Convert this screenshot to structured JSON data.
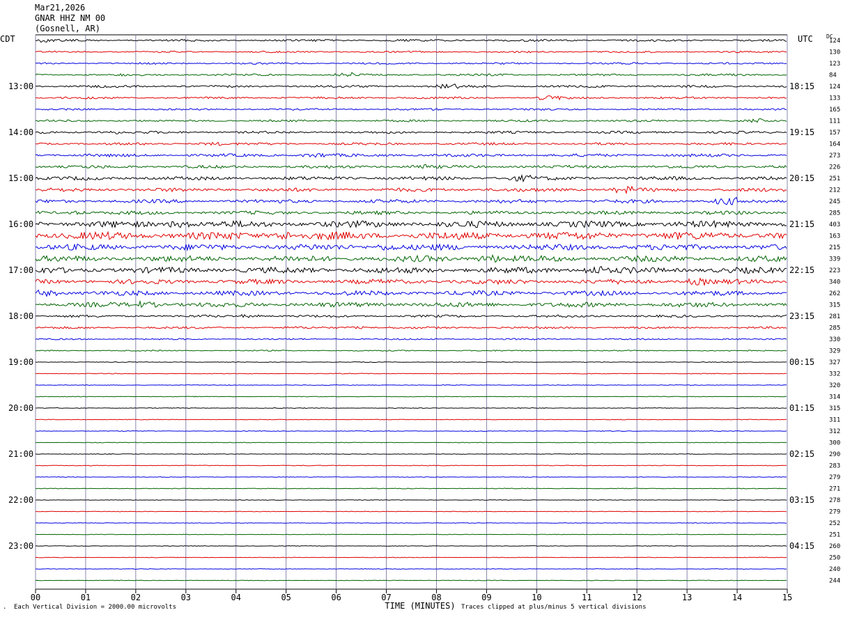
{
  "header": {
    "date": "Mar21,2026",
    "station": "GNAR HHZ NM 00",
    "location": "(Gosnell, AR)"
  },
  "left_label": "CDT",
  "right_label": "UTC",
  "dc_label": "DC",
  "footer": {
    "scale_note": "Each Vertical Division = 2000.00 microvolts",
    "xlabel": "TIME (MINUTES)",
    "clip_note": "Traces clipped at plus/minus 5 vertical divisions",
    "corner_mark": "."
  },
  "colors": {
    "cycle": [
      "#000000",
      "#e00000",
      "#0000e0",
      "#006400"
    ],
    "grid": "#6a6a9a"
  },
  "chart_data": {
    "type": "line",
    "title": "GNAR HHZ NM 00",
    "xlabel": "TIME (MINUTES)",
    "xlim": [
      0,
      15
    ],
    "x_ticks": [
      "00",
      "01",
      "02",
      "03",
      "04",
      "05",
      "06",
      "07",
      "08",
      "09",
      "10",
      "11",
      "12",
      "13",
      "14",
      "15"
    ],
    "left_times": [
      "13:00",
      "14:00",
      "15:00",
      "16:00",
      "17:00",
      "18:00",
      "19:00",
      "20:00",
      "21:00",
      "22:00",
      "23:00"
    ],
    "right_times": [
      "18:15",
      "19:15",
      "20:15",
      "21:15",
      "22:15",
      "23:15",
      "00:15",
      "01:15",
      "02:15",
      "03:15",
      "04:15"
    ],
    "dc_offsets": [
      124,
      130,
      123,
      84,
      124,
      133,
      165,
      111,
      157,
      164,
      273,
      226,
      251,
      212,
      245,
      285,
      403,
      163,
      215,
      339,
      223,
      340,
      262,
      315,
      281,
      285,
      330,
      329,
      327,
      332,
      320,
      314,
      315,
      311,
      312,
      300,
      290,
      283,
      279,
      271,
      278,
      279,
      252,
      251,
      260,
      250,
      240,
      244
    ],
    "trace_amplitudes": [
      0.35,
      0.3,
      0.3,
      0.35,
      0.4,
      0.35,
      0.3,
      0.35,
      0.4,
      0.4,
      0.5,
      0.5,
      0.6,
      0.6,
      0.6,
      0.6,
      1.1,
      1.3,
      1.0,
      1.0,
      1.0,
      0.8,
      0.8,
      0.8,
      0.4,
      0.35,
      0.25,
      0.2,
      0.12,
      0.12,
      0.12,
      0.1,
      0.12,
      0.1,
      0.12,
      0.1,
      0.1,
      0.12,
      0.1,
      0.12,
      0.1,
      0.1,
      0.1,
      0.1,
      0.1,
      0.1,
      0.1,
      0.1
    ]
  }
}
